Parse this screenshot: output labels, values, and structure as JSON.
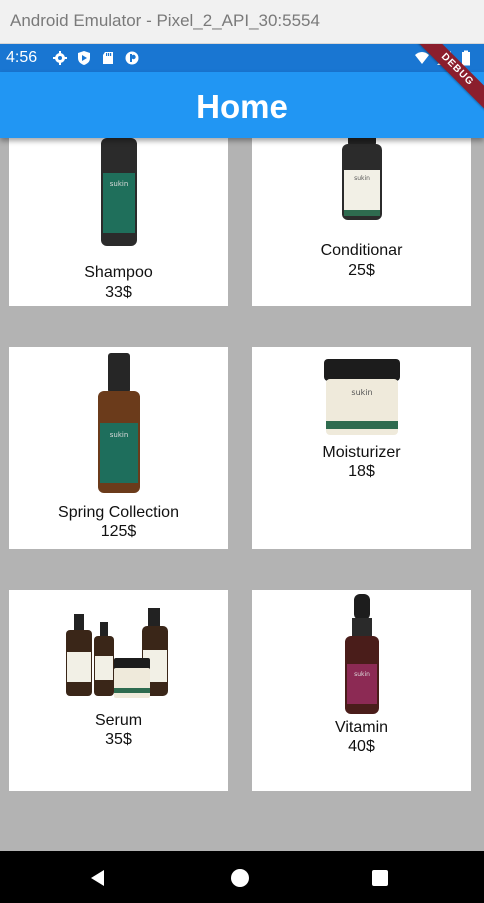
{
  "window": {
    "title": "Android Emulator - Pixel_2_API_30:5554"
  },
  "status_bar": {
    "time": "4:56",
    "icons": [
      "settings-icon",
      "shield-icon",
      "sd-card-icon",
      "sync-icon"
    ],
    "right_icons": [
      "wifi-icon",
      "signal-icon",
      "battery-icon"
    ]
  },
  "app_bar": {
    "title": "Home",
    "debug_label": "DEBUG",
    "color": "#2196f3"
  },
  "products": [
    {
      "name": "Shampoo",
      "price": "33$",
      "image": "tall-bottle"
    },
    {
      "name": "Conditionar",
      "price": "25$",
      "image": "short-bottle"
    },
    {
      "name": "Spring Collection",
      "price": "125$",
      "image": "pump-bottle"
    },
    {
      "name": "Moisturizer",
      "price": "18$",
      "image": "jar"
    },
    {
      "name": "Serum",
      "price": "35$",
      "image": "set"
    },
    {
      "name": "Vitamin",
      "price": "40$",
      "image": "dropper"
    }
  ],
  "nav_bar": {
    "buttons": [
      "back-icon",
      "home-icon",
      "recents-icon"
    ]
  }
}
